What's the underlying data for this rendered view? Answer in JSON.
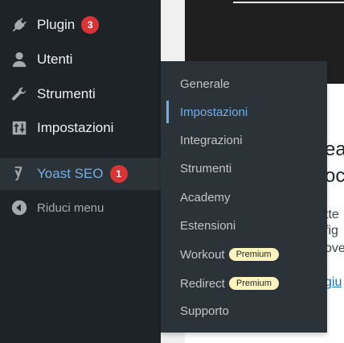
{
  "sidebar": {
    "items": [
      {
        "label": "Plugin",
        "icon": "plugin-icon",
        "badge": "3"
      },
      {
        "label": "Utenti",
        "icon": "user-icon"
      },
      {
        "label": "Strumenti",
        "icon": "wrench-icon"
      },
      {
        "label": "Impostazioni",
        "icon": "settings-sliders-icon"
      },
      {
        "label": "Yoast SEO",
        "icon": "yoast-icon",
        "badge": "1"
      },
      {
        "label": "Riduci menu",
        "icon": "collapse-arrow-icon"
      }
    ]
  },
  "submenu": {
    "items": [
      {
        "label": "Generale"
      },
      {
        "label": "Impostazioni",
        "current": true
      },
      {
        "label": "Integrazioni"
      },
      {
        "label": "Strumenti"
      },
      {
        "label": "Academy"
      },
      {
        "label": "Estensioni"
      },
      {
        "label": "Workout",
        "tag": "Premium"
      },
      {
        "label": "Redirect",
        "tag": "Premium"
      },
      {
        "label": "Supporto"
      }
    ]
  },
  "background": {
    "h1": "ea",
    "h2": "oc",
    "p1": "tte",
    "p2": "fig",
    "p3": "ove",
    "link": "giu"
  },
  "colors": {
    "sidebar_bg": "#1d2327",
    "submenu_bg": "#2c3338",
    "accent": "#72aee6",
    "badge": "#d63638",
    "premium_bg": "#fff4bf"
  }
}
